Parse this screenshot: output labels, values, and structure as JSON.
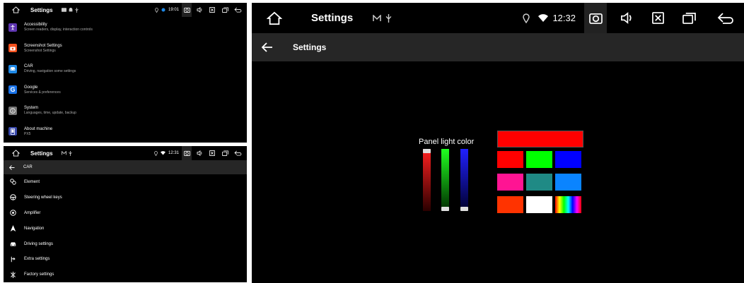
{
  "colors": {
    "background": "#000000",
    "header_bar": "#262626",
    "text_primary": "#ffffff",
    "text_secondary": "#aaaaaa",
    "accessibility_icon": "#5e35b1",
    "screenshot_icon": "#f4511e",
    "car_icon": "#1e88e5",
    "google_icon": "#1a73e8",
    "system_icon": "#757575",
    "about_icon": "#3949ab"
  },
  "panel_a": {
    "status": {
      "title": "Settings",
      "time": "19:01"
    },
    "items": [
      {
        "title": "Accessibility",
        "subtitle": "Screen readers, display, interaction controls",
        "icon": "accessibility-icon"
      },
      {
        "title": "Screenshot Settings",
        "subtitle": "Screenshot Settings",
        "icon": "camera-icon"
      },
      {
        "title": "CAR",
        "subtitle": "Driving, navigation some settings",
        "icon": "car-icon"
      },
      {
        "title": "Google",
        "subtitle": "Services & preferences",
        "icon": "google-icon"
      },
      {
        "title": "System",
        "subtitle": "Languages, time, update, backup",
        "icon": "info-icon"
      },
      {
        "title": "About machine",
        "subtitle": "PX5",
        "icon": "phone-icon"
      }
    ]
  },
  "panel_b": {
    "status": {
      "title": "Settings",
      "time": "12:31"
    },
    "header_title": "CAR",
    "items": [
      {
        "label": "Element",
        "icon": "element-icon"
      },
      {
        "label": "Steering wheel keys",
        "icon": "steering-wheel-icon"
      },
      {
        "label": "Amplifier",
        "icon": "amplifier-icon"
      },
      {
        "label": "Navigation",
        "icon": "navigation-arrow-icon"
      },
      {
        "label": "Driving settings",
        "icon": "car-icon"
      },
      {
        "label": "Extra settings",
        "icon": "extra-settings-icon"
      },
      {
        "label": "Factory settings",
        "icon": "factory-icon"
      }
    ]
  },
  "panel_c": {
    "status": {
      "title": "Settings",
      "time": "12:32"
    },
    "header_title": "Settings",
    "panel_light_label": "Panel light color",
    "sliders": [
      {
        "channel": "red",
        "level": 1.0,
        "top_color": "#ff2020",
        "bottom_color": "#2a0000"
      },
      {
        "channel": "green",
        "level": 0.0,
        "top_color": "#20ff20",
        "bottom_color": "#002a00"
      },
      {
        "channel": "blue",
        "level": 0.0,
        "top_color": "#2020ff",
        "bottom_color": "#00002a"
      }
    ],
    "preview_color": "#ff0000",
    "swatches": [
      "#ff0000",
      "#00ff00",
      "#0000ff",
      "#ff1493",
      "#1f8a85",
      "#0a84ff",
      "#ff3300",
      "#ffffff",
      "rainbow"
    ]
  }
}
